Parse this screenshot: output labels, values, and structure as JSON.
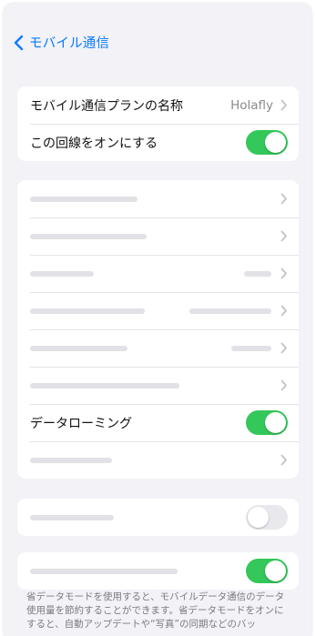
{
  "nav": {
    "back_label": "モバイル通信"
  },
  "plan_group": {
    "plan_name_label": "モバイル通信プランの名称",
    "plan_name_value": "Holafly",
    "line_on_label": "この回線をオンにする",
    "line_on": true
  },
  "settings_group": {
    "roaming_label": "データローミング",
    "roaming_on": true
  },
  "toggle_group_2": {
    "on": false
  },
  "toggle_group_3": {
    "on": true
  },
  "footnote": "省データモードを使用すると、モバイルデータ通信のデータ使用量を節約することができます。省データモードをオンにすると、自動アップデートや“写真”の同期などのバッ",
  "colors": {
    "accent": "#0a7aff",
    "toggle_on": "#34c759",
    "background": "#f2f2f7"
  }
}
